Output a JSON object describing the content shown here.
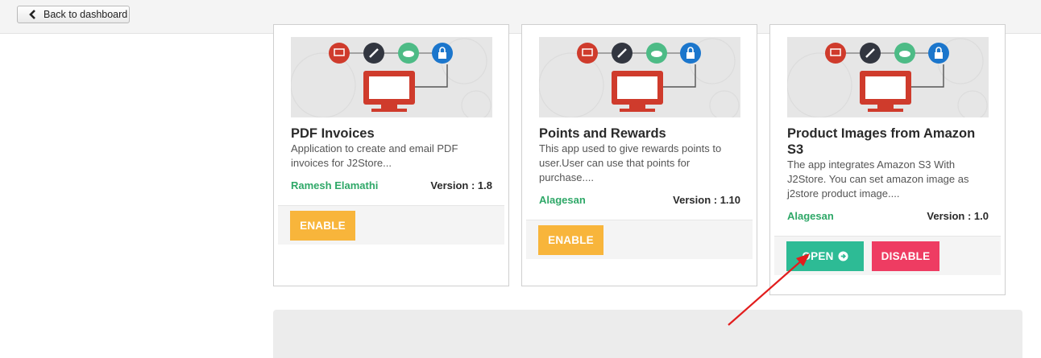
{
  "header": {
    "back_label": "Back to dashboard",
    "back_icon": "chevron-left-icon"
  },
  "thumbnail_icons": [
    "presentation-icon",
    "link-icon",
    "cloud-download-icon",
    "lock-icon",
    "monitor-icon"
  ],
  "colors": {
    "red": "#cf3b2c",
    "dark": "#323640",
    "green": "#4dbb86",
    "blue": "#1b76cc",
    "enable": "#f8b53b",
    "open": "#2dbb95",
    "disable": "#ee3c62",
    "author": "#2fa868"
  },
  "cards": [
    {
      "title": "PDF Invoices",
      "description": "Application to create and email PDF invoices for J2Store...",
      "author": "Ramesh Elamathi",
      "version": "Version : 1.8",
      "buttons": [
        "ENABLE"
      ]
    },
    {
      "title": "Points and Rewards",
      "description": "This app used to give rewards points to user.User can use that points for purchase....",
      "author": "Alagesan",
      "version": "Version : 1.10",
      "buttons": [
        "ENABLE"
      ]
    },
    {
      "title": "Product Images from Amazon S3",
      "description": "The app integrates Amazon S3 With J2Store. You can set amazon image as j2store product image....",
      "author": "Alagesan",
      "version": "Version : 1.0",
      "buttons": [
        "OPEN",
        "DISABLE"
      ]
    }
  ]
}
